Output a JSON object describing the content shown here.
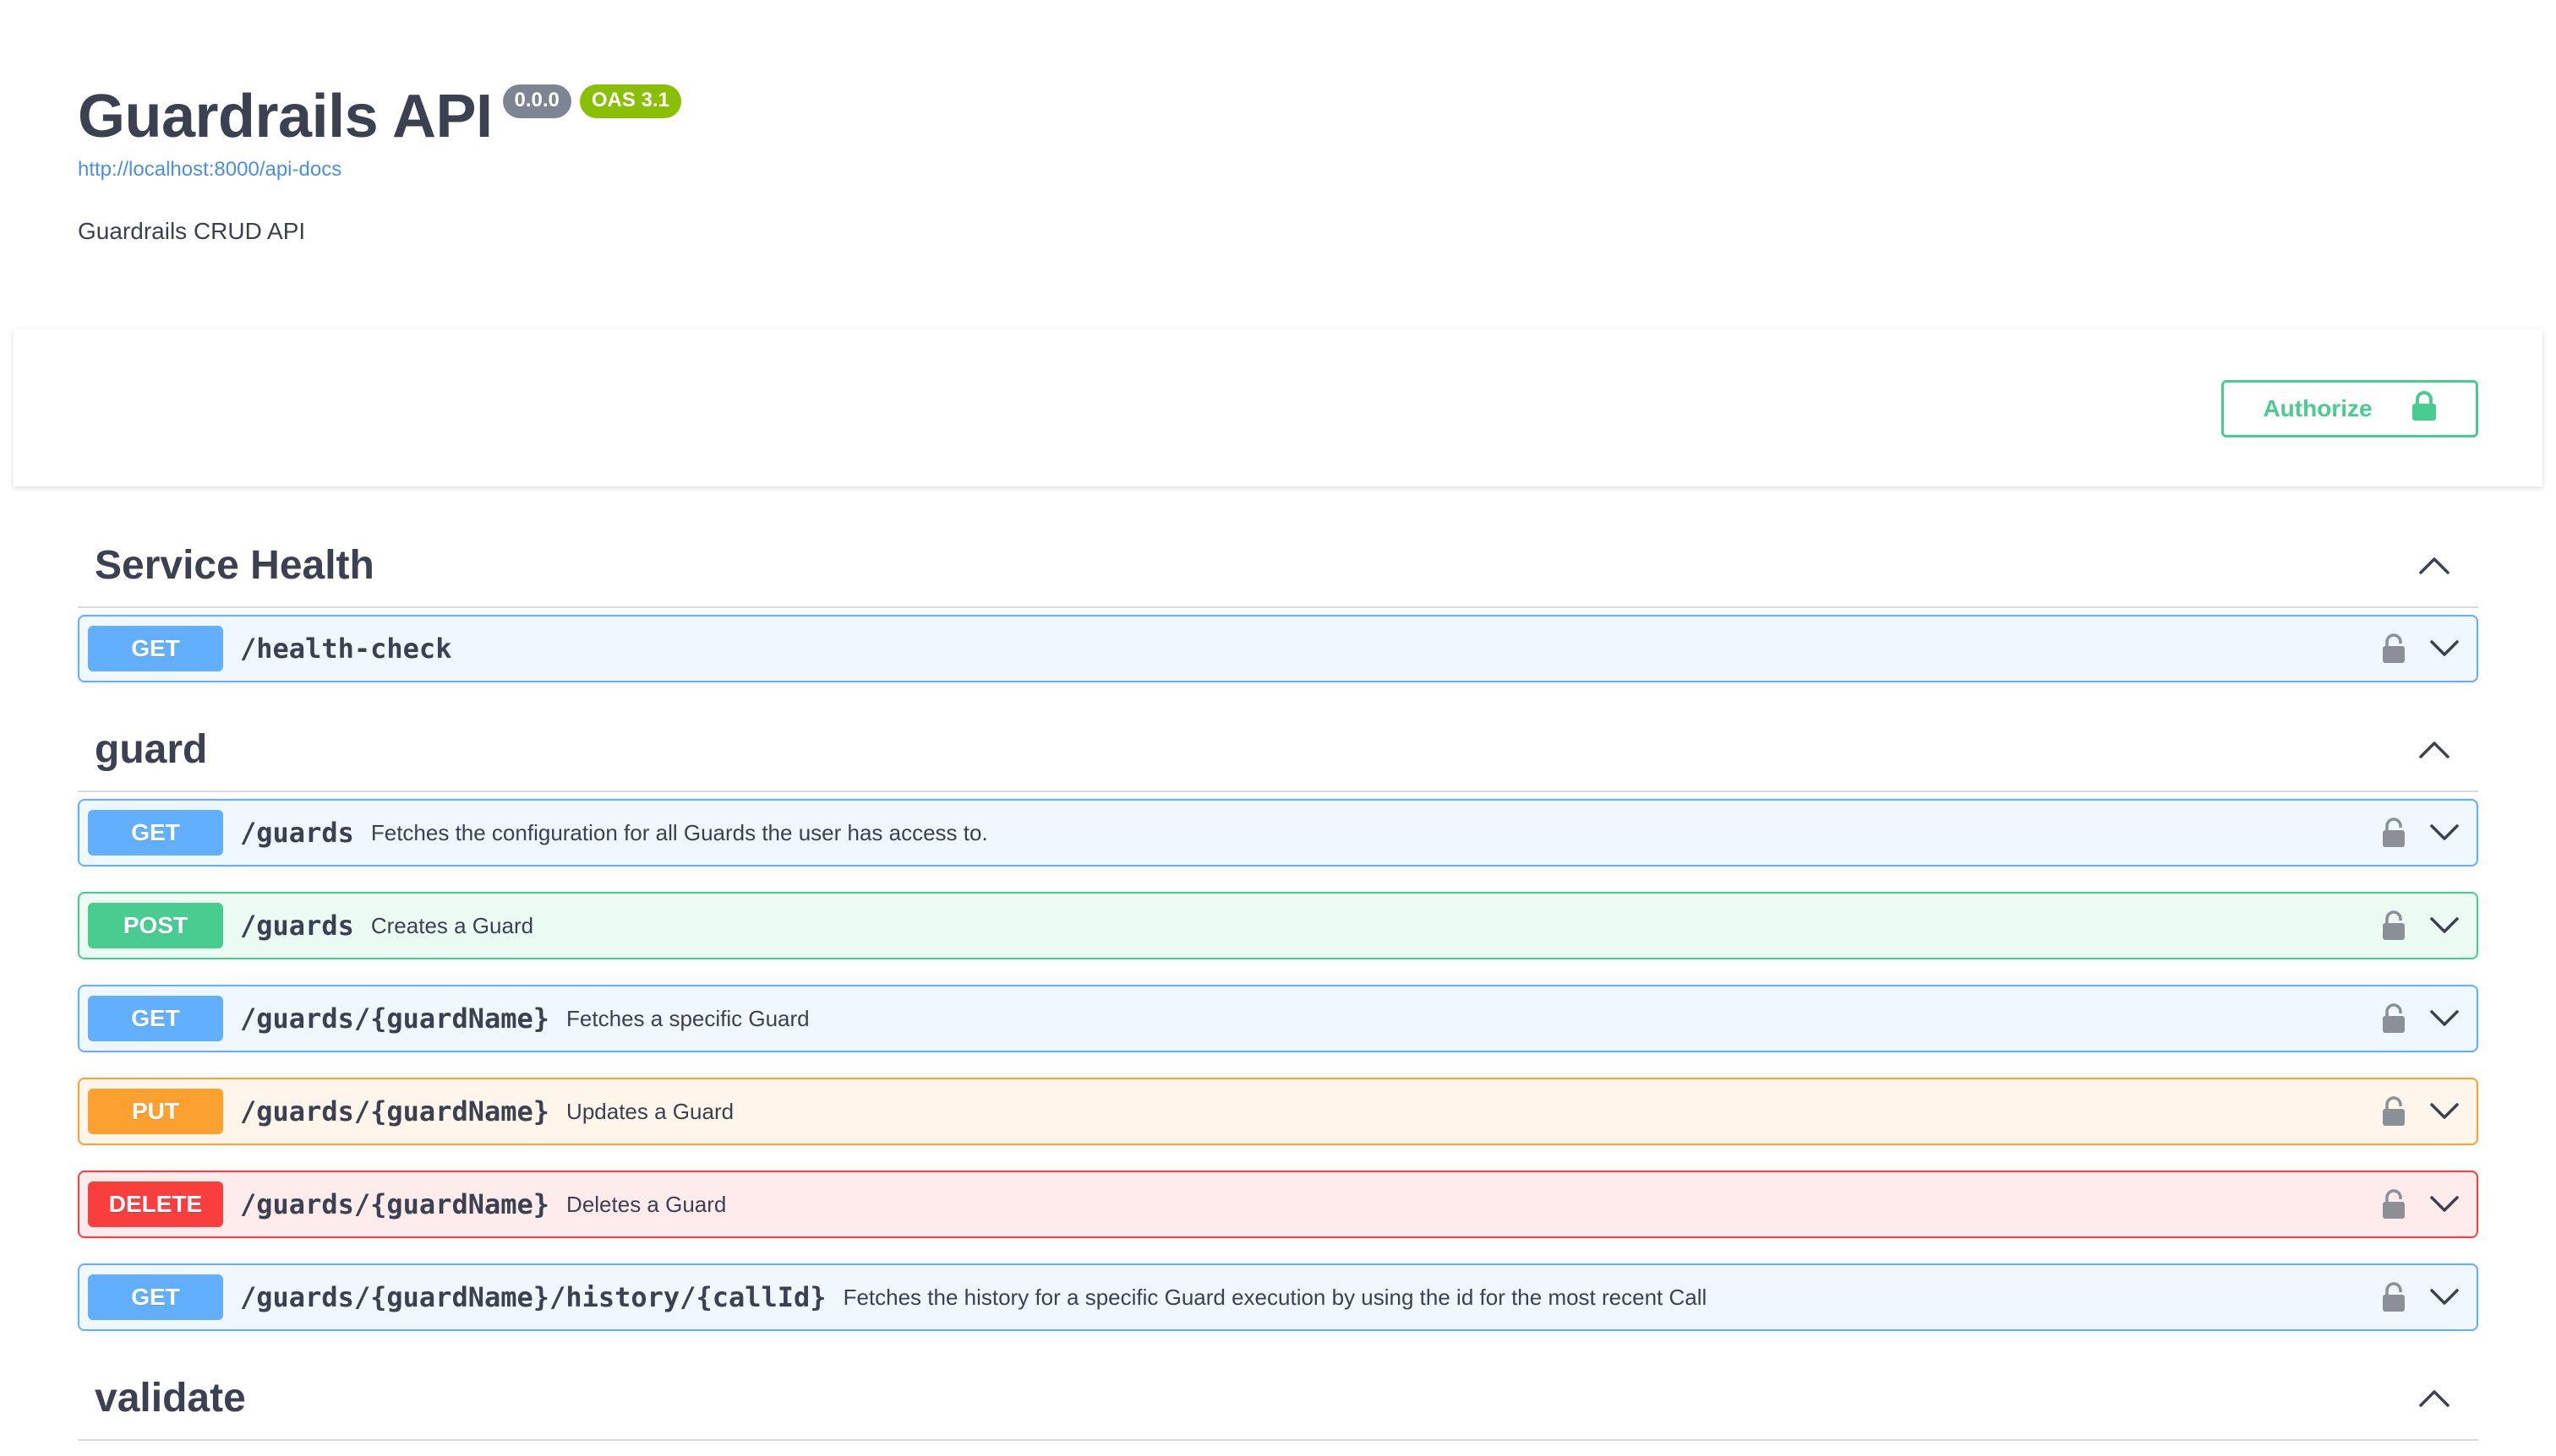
{
  "info": {
    "title": "Guardrails API",
    "version": "0.0.0",
    "oas": "OAS 3.1",
    "spec_link": "http://localhost:8000/api-docs",
    "description": "Guardrails CRUD API"
  },
  "authorize": {
    "label": "Authorize"
  },
  "colors": {
    "get": "#61affe",
    "post": "#49cc90",
    "put": "#fca130",
    "delete": "#f93e3e"
  },
  "icons": {
    "authorize": "lock-icon",
    "operation_lock": "unlocked-padlock-icon",
    "operation_expand": "chevron-down-icon",
    "tag_collapse": "chevron-up-icon"
  },
  "tags": [
    {
      "name": "Service Health",
      "operations": [
        {
          "method": "GET",
          "path": "/health-check",
          "summary": ""
        }
      ]
    },
    {
      "name": "guard",
      "operations": [
        {
          "method": "GET",
          "path": "/guards",
          "summary": "Fetches the configuration for all Guards the user has access to."
        },
        {
          "method": "POST",
          "path": "/guards",
          "summary": "Creates a Guard"
        },
        {
          "method": "GET",
          "path": "/guards/{guardName}",
          "summary": "Fetches a specific Guard"
        },
        {
          "method": "PUT",
          "path": "/guards/{guardName}",
          "summary": "Updates a Guard"
        },
        {
          "method": "DELETE",
          "path": "/guards/{guardName}",
          "summary": "Deletes a Guard"
        },
        {
          "method": "GET",
          "path": "/guards/{guardName}/history/{callId}",
          "summary": "Fetches the history for a specific Guard execution by using the id for the most recent Call"
        }
      ]
    },
    {
      "name": "validate",
      "operations": []
    }
  ]
}
